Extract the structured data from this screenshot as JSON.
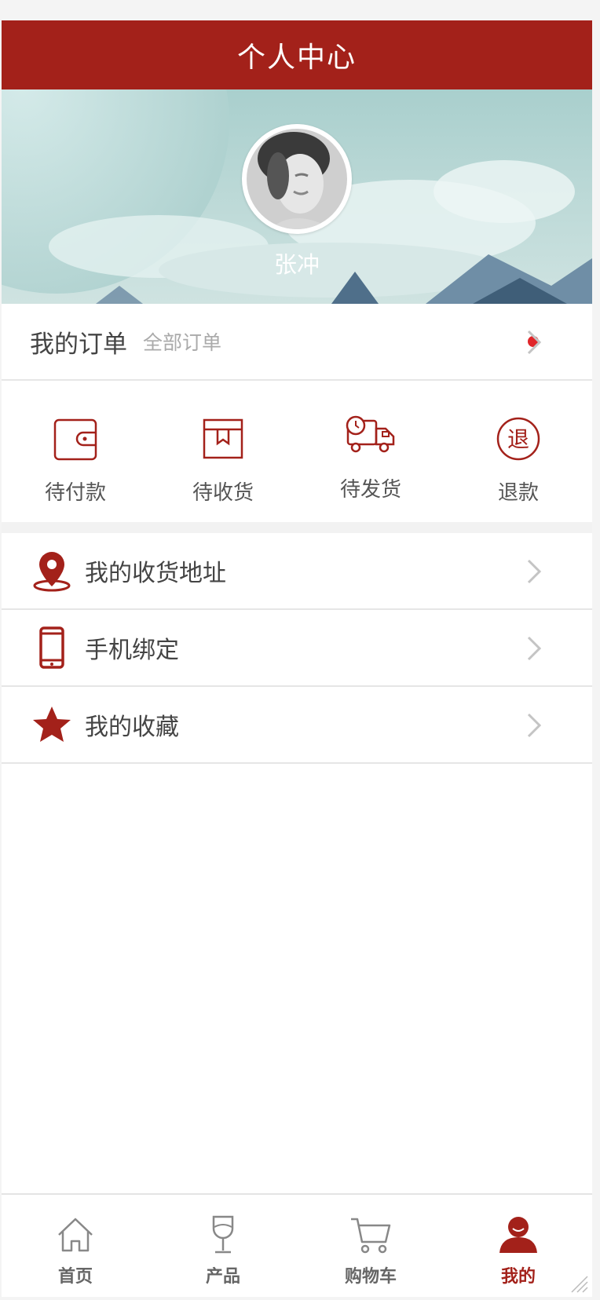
{
  "colors": {
    "brand": "#a3211a",
    "header_bg": "#a3211a",
    "dot": "#e0262a"
  },
  "header": {
    "title": "个人中心"
  },
  "profile": {
    "name": "张冲",
    "avatar_icon": "user-photo"
  },
  "orders": {
    "title": "我的订单",
    "all_label": "全部订单",
    "has_notice": true,
    "items": [
      {
        "label": "待付款",
        "icon": "wallet-icon"
      },
      {
        "label": "待收货",
        "icon": "box-icon"
      },
      {
        "label": "待发货",
        "icon": "truck-icon"
      },
      {
        "label": "退款",
        "icon": "refund-icon",
        "glyph": "退"
      }
    ]
  },
  "menu": [
    {
      "label": "我的收货地址",
      "icon": "location-pin-icon"
    },
    {
      "label": "手机绑定",
      "icon": "phone-icon"
    },
    {
      "label": "我的收藏",
      "icon": "star-icon"
    }
  ],
  "tabbar": {
    "items": [
      {
        "label": "首页",
        "icon": "home-icon",
        "active": false
      },
      {
        "label": "产品",
        "icon": "wine-glass-icon",
        "active": false
      },
      {
        "label": "购物车",
        "icon": "cart-icon",
        "active": false
      },
      {
        "label": "我的",
        "icon": "user-icon",
        "active": true
      }
    ]
  }
}
